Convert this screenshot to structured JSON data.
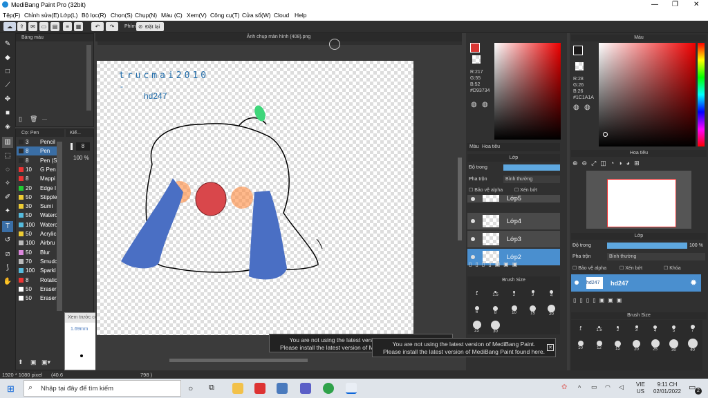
{
  "app": {
    "title": "MediBang Paint Pro (32bit)"
  },
  "menu": [
    "Tệp(F)",
    "Chỉnh sửa(E)",
    "Lớp(L)",
    "Bộ lọc(R)",
    "Chọn(S)",
    "Chụp(N)",
    "Màu (C)",
    "Xem(V)",
    "Công cụ(T)",
    "Cửa sổ(W)",
    "Cloud",
    "Help"
  ],
  "toolbar": {
    "shortcut_label": "Phím",
    "reset_label": "Đặt lại"
  },
  "color_palette_panel": {
    "title": "Bảng màu"
  },
  "brush_panel": {
    "title": "Cọ: Pen",
    "side_title": "Kiể...",
    "size_value": "8",
    "opacity_value": "100 %",
    "brushes": [
      {
        "size": "3",
        "name": "Pencil",
        "color": "#2a2a2a"
      },
      {
        "size": "8",
        "name": "Pen",
        "color": "#2a2a2a"
      },
      {
        "size": "8",
        "name": "Pen (S",
        "color": "#2a2a2a"
      },
      {
        "size": "10",
        "name": "G Pen",
        "color": "#e33"
      },
      {
        "size": "8",
        "name": "Mappi",
        "color": "#e33"
      },
      {
        "size": "20",
        "name": "Edge I",
        "color": "#2c3"
      },
      {
        "size": "50",
        "name": "Stipple",
        "color": "#ec3"
      },
      {
        "size": "30",
        "name": "Sumi",
        "color": "#ec3"
      },
      {
        "size": "50",
        "name": "Watero",
        "color": "#5bd"
      },
      {
        "size": "100",
        "name": "Watero",
        "color": "#5bd"
      },
      {
        "size": "50",
        "name": "Acrylic",
        "color": "#ec3"
      },
      {
        "size": "100",
        "name": "Airbru",
        "color": "#bbb"
      },
      {
        "size": "50",
        "name": "Blur",
        "color": "#d8d"
      },
      {
        "size": "70",
        "name": "Smudc",
        "color": "#bbb"
      },
      {
        "size": "100",
        "name": "Sparkl",
        "color": "#5bd"
      },
      {
        "size": "8",
        "name": "Rotatic",
        "color": "#e33"
      },
      {
        "size": "50",
        "name": "Eraser",
        "color": "#fff"
      },
      {
        "size": "50",
        "name": "Eraser",
        "color": "#fff"
      }
    ]
  },
  "preview": {
    "title": "Xem trước cọ",
    "size": "1.69mm"
  },
  "canvas": {
    "title": "Ảnh chụp màn hình (408).png",
    "text1": "trucmai2010",
    "text2": "-",
    "text3": "hd247"
  },
  "status": {
    "dimensions": "1920 * 1080 pixel",
    "zoom": "(40.6",
    "coords": "798 )"
  },
  "color_mid": {
    "r": "R:217",
    "g": "G:55",
    "b": "B:52",
    "hex": "#D93734",
    "tab1": "Màu",
    "tab2": "Hoa tiêu"
  },
  "layer_mid": {
    "title": "Lớp",
    "opacity_label": "Độ trong",
    "blend_label": "Pha trộn",
    "blend_value": "Bình thường",
    "protect_alpha": "Bảo vệ alpha",
    "clip": "Xén bớt",
    "layers": [
      {
        "name": "Lớp5"
      },
      {
        "name": "Lớp4"
      },
      {
        "name": "Lớp3"
      },
      {
        "name": "Lớp2"
      }
    ]
  },
  "brush_size_panel": {
    "title": "Brush Size",
    "sizes_mid": [
      "1",
      "1.5",
      "2",
      "3",
      "4",
      "6",
      "8",
      "10",
      "15",
      "20",
      "25",
      "30"
    ],
    "sizes_right": [
      "1",
      "1.5",
      "2",
      "3",
      "4",
      "5",
      "7",
      "10",
      "12",
      "15",
      "20",
      "25",
      "30",
      "40"
    ]
  },
  "color_right": {
    "title": "Màu",
    "r": "R:28",
    "g": "G:26",
    "b": "B:26",
    "hex": "#1C1A1A"
  },
  "navigator": {
    "title": "Hoa tiêu"
  },
  "layer_right": {
    "title": "Lớp",
    "opacity_label": "Độ trong",
    "opacity_value": "100 %",
    "blend_label": "Pha trộn",
    "blend_value": "Bình thường",
    "protect_alpha": "Bảo vệ alpha",
    "clip": "Xén bớt",
    "lock": "Khóa",
    "layer_thumb": "hd247",
    "layer_name": "hd247"
  },
  "notices": [
    {
      "line1": "You are not using the latest version of MediBang Paint.",
      "line2": "Please install the latest version of MediBang Paint found here."
    },
    {
      "line1": "You are not using the latest version of MediBang Paint.",
      "line2": "Please install the latest version of MediBang Paint found here."
    }
  ],
  "taskbar": {
    "search_placeholder": "Nhập tại đây để tìm kiếm",
    "lang1": "VIE",
    "lang2": "US",
    "time": "9:11 CH",
    "date": "02/01/2022",
    "notif_count": "2"
  }
}
